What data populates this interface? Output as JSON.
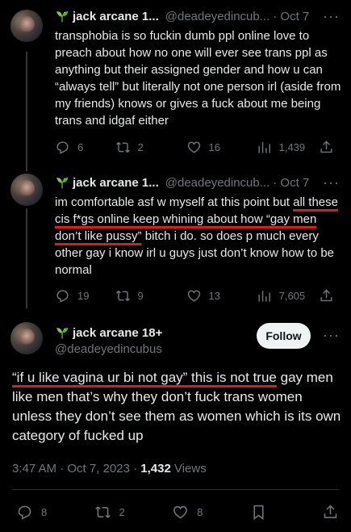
{
  "tweets": [
    {
      "name": "jack arcane 1...",
      "handle": "@deadeyedincub...",
      "time": "· Oct 7",
      "text": "transphobia is so fuckin dumb ppl online love to preach about how no one will ever see trans ppl as anything but their assigned gender and how u can “always tell” but literally not one person irl (aside from my friends) knows or gives a fuck about me being trans and idgaf either",
      "replies": "6",
      "reposts": "2",
      "likes": "16",
      "views": "1,439"
    },
    {
      "name": "jack arcane 1...",
      "handle": "@deadeyedincub...",
      "time": "· Oct 7",
      "text_before": "im comfortable asf w myself at this point but ",
      "text_underlined": "all these cis f*gs online keep whining about how “gay men don’t like pussy”",
      "text_after": " bitch i do. so does p much every other gay i know irl u guys just don’t know how to be normal",
      "replies": "19",
      "reposts": "9",
      "likes": "13",
      "views": "7,605"
    }
  ],
  "main": {
    "name": "jack arcane 18+",
    "handle": "@deadeyedincubus",
    "follow_label": "Follow",
    "text_underlined": "“if u like vagina ur bi not gay” this is not true",
    "text_after": " gay men like men that’s why they don’t fuck trans women unless they don’t see them as women which is its own category of fucked up",
    "timestamp": "3:47 AM · Oct 7, 2023 · ",
    "views_count": "1,432",
    "views_label": " Views",
    "replies": "8",
    "reposts": "2",
    "likes": "8"
  },
  "icons": {
    "avatar": "user-avatar",
    "emoji": "seedling-emoji",
    "more": "more-dots-icon",
    "reply": "reply-icon",
    "repost": "repost-icon",
    "like": "heart-icon",
    "views": "views-chart-icon",
    "share": "share-icon",
    "bookmark": "bookmark-icon"
  },
  "colors": {
    "background": "#000000",
    "text": "#e7e9ea",
    "muted": "#71767b",
    "underline": "#d21f22",
    "follow_bg": "#eff3f4"
  }
}
